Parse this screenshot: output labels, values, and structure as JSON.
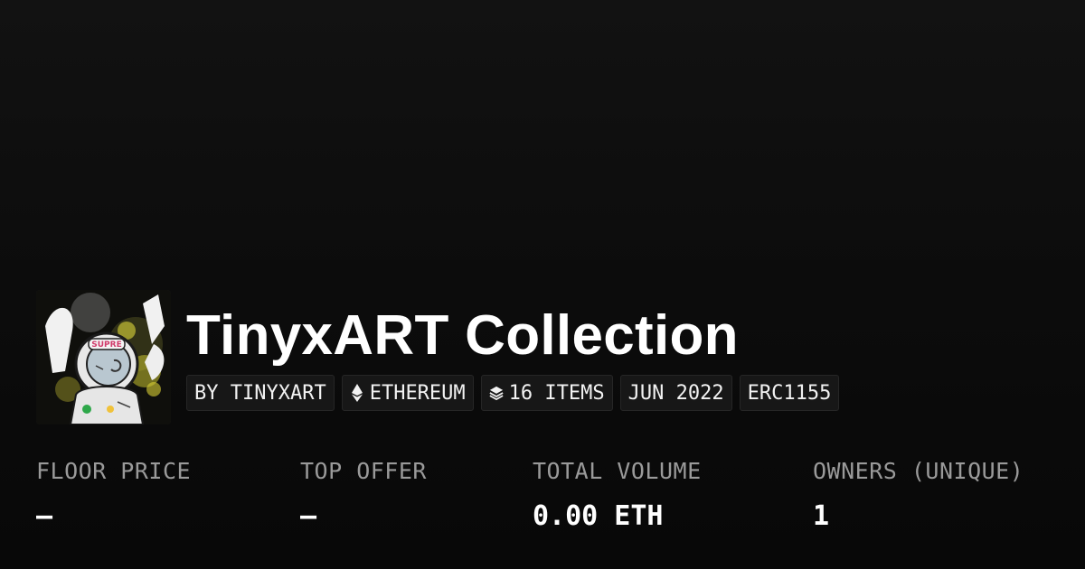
{
  "collection": {
    "title": "TinyxART Collection",
    "avatar_icon": "astronaut-art-icon"
  },
  "chips": [
    {
      "label": "BY TINYXART",
      "icon": null
    },
    {
      "label": "ETHEREUM",
      "icon": "ethereum-icon"
    },
    {
      "label": "16 ITEMS",
      "icon": "layers-icon"
    },
    {
      "label": "JUN 2022",
      "icon": null
    },
    {
      "label": "ERC1155",
      "icon": null
    }
  ],
  "stats": [
    {
      "label": "FLOOR PRICE",
      "value": "—"
    },
    {
      "label": "TOP OFFER",
      "value": "—"
    },
    {
      "label": "TOTAL VOLUME",
      "value": "0.00 ETH"
    },
    {
      "label": "OWNERS (UNIQUE)",
      "value": "1"
    }
  ],
  "colors": {
    "background": "#0a0a0a",
    "chip_background": "#171717",
    "label_gray": "#9a9a9a",
    "text": "#ffffff"
  }
}
